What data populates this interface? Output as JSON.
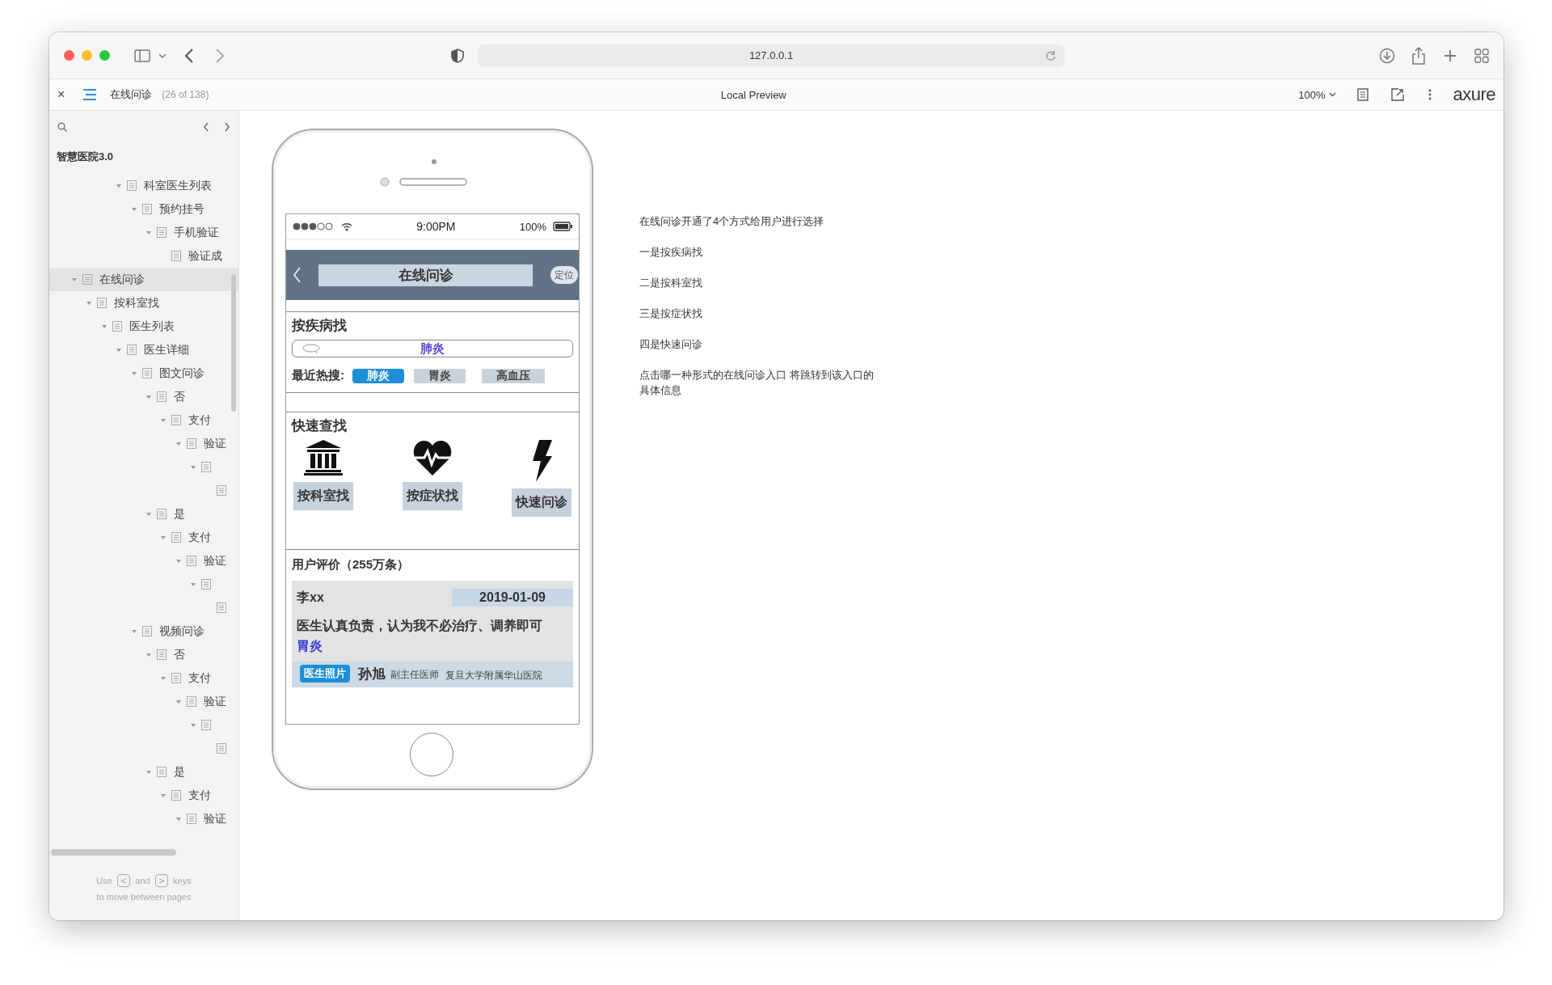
{
  "browser": {
    "address": "127.0.0.1"
  },
  "axure_bar": {
    "close": "×",
    "page_title": "在线问诊",
    "page_count": "(26 of 138)",
    "center_title": "Local Preview",
    "zoom": "100%",
    "logo": "axure"
  },
  "sidebar": {
    "project": "智慧医院3.0",
    "tree_above": [
      {
        "label": "科室医生列表",
        "selected": false,
        "expanded": true,
        "children": [
          {
            "label": "预约挂号",
            "selected": false,
            "expanded": true,
            "children": [
              {
                "label": "手机验证",
                "selected": false,
                "expanded": true,
                "children": [
                  {
                    "label": "验证成",
                    "selected": false
                  }
                ]
              }
            ]
          }
        ]
      }
    ],
    "tree": [
      {
        "label": "在线问诊",
        "selected": true,
        "expanded": true,
        "children": [
          {
            "label": "按科室找",
            "selected": false,
            "expanded": true,
            "children": [
              {
                "label": "医生列表",
                "selected": false,
                "expanded": true,
                "children": [
                  {
                    "label": "医生详细",
                    "selected": false,
                    "expanded": true,
                    "children": [
                      {
                        "label": "图文问诊",
                        "selected": false,
                        "expanded": true,
                        "children": [
                          {
                            "label": "否",
                            "selected": false,
                            "expanded": true,
                            "children": [
                              {
                                "label": "支付",
                                "selected": false,
                                "expanded": true,
                                "children": [
                                  {
                                    "label": "验证",
                                    "selected": false,
                                    "expanded": true,
                                    "children": [
                                      {
                                        "selected": false,
                                        "expanded": true,
                                        "children": [
                                          {
                                            "selected": false
                                          }
                                        ]
                                      }
                                    ]
                                  }
                                ]
                              }
                            ]
                          },
                          {
                            "label": "是",
                            "selected": false,
                            "expanded": true,
                            "children": [
                              {
                                "label": "支付",
                                "selected": false,
                                "expanded": true,
                                "children": [
                                  {
                                    "label": "验证",
                                    "selected": false,
                                    "expanded": true,
                                    "children": [
                                      {
                                        "selected": false,
                                        "expanded": true,
                                        "children": [
                                          {
                                            "selected": false
                                          }
                                        ]
                                      }
                                    ]
                                  }
                                ]
                              }
                            ]
                          }
                        ]
                      },
                      {
                        "label": "视频问诊",
                        "selected": false,
                        "expanded": true,
                        "children": [
                          {
                            "label": "否",
                            "selected": false,
                            "expanded": true,
                            "children": [
                              {
                                "label": "支付",
                                "selected": false,
                                "expanded": true,
                                "children": [
                                  {
                                    "label": "验证",
                                    "selected": false,
                                    "expanded": true,
                                    "children": [
                                      {
                                        "selected": false,
                                        "expanded": true,
                                        "children": [
                                          {
                                            "selected": false
                                          }
                                        ]
                                      }
                                    ]
                                  }
                                ]
                              }
                            ]
                          },
                          {
                            "label": "是",
                            "selected": false,
                            "expanded": true,
                            "children": [
                              {
                                "label": "支付",
                                "selected": false,
                                "expanded": true,
                                "children": [
                                  {
                                    "label": "验证",
                                    "selected": false,
                                    "expanded": true
                                  }
                                ]
                              }
                            ]
                          }
                        ]
                      }
                    ]
                  }
                ]
              }
            ]
          }
        ]
      }
    ],
    "footer": {
      "use": "Use",
      "key_prev": "<",
      "and": "and",
      "key_next": ">",
      "keys": "keys",
      "hint": "to move between pages"
    }
  },
  "phone": {
    "time": "9:00PM",
    "battery": "100%",
    "nav_title": "在线问诊",
    "locate": "定位",
    "disease_section": {
      "title": "按疾病找",
      "search_value": "肺炎",
      "hot_label": "最近热搜:",
      "hot_tags": [
        {
          "label": "肺炎",
          "selected": true
        },
        {
          "label": "胃炎",
          "selected": false
        },
        {
          "label": "高血压",
          "selected": false
        }
      ]
    },
    "quick_section": {
      "title": "快速查找",
      "items": [
        {
          "kind": "building",
          "label": "按科室找"
        },
        {
          "kind": "heartbeat",
          "label": "按症状找"
        },
        {
          "kind": "bolt",
          "label": "快速问诊"
        }
      ]
    },
    "reviews": {
      "title": "用户评价（255万条）",
      "user": "李xx",
      "date": "2019-01-09",
      "comment": "医生认真负责，认为我不必治疗、调养即可",
      "tag": "胃炎",
      "photo_badge": "医生照片",
      "doctor": "孙旭",
      "doctor_title": "副主任医师",
      "hospital": "复旦大学附属华山医院"
    }
  },
  "notes": [
    "在线问诊开通了4个方式给用户进行选择",
    "一是按疾病找",
    "二是按科室找",
    "三是按症状找",
    "四是快速问诊",
    "点击哪一种形式的在线问诊入口 将跳转到该入口的具体信息"
  ]
}
